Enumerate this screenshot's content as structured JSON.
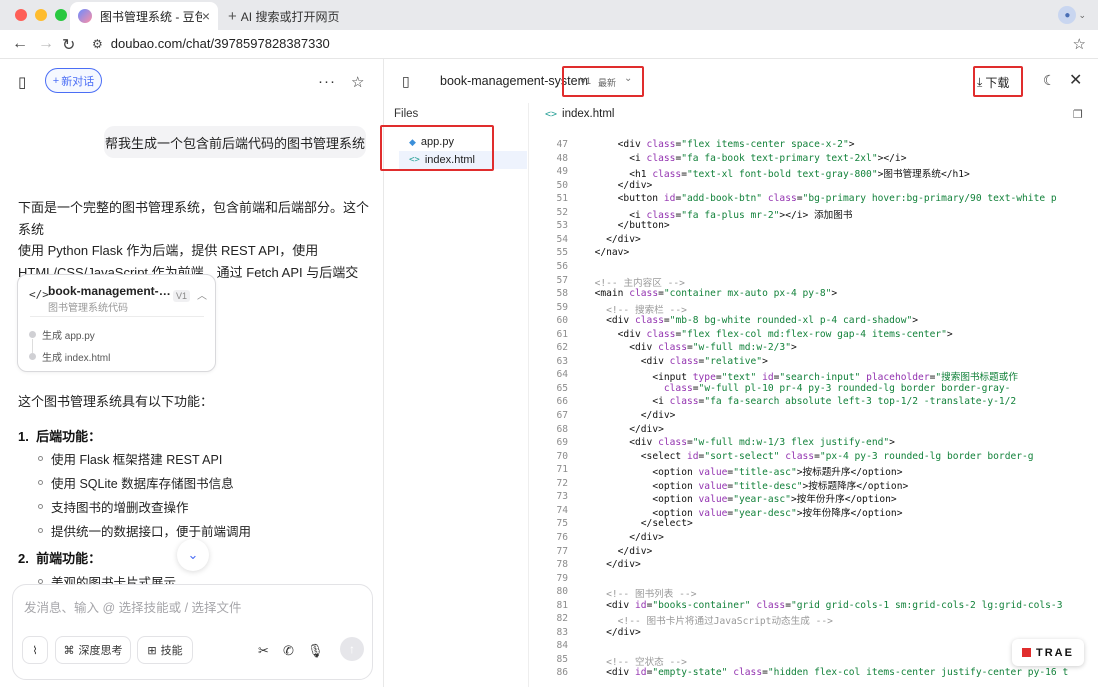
{
  "browser": {
    "tab_title": "图书管理系统 - 豆包",
    "new_tab_label": "AI 搜索或打开网页",
    "url": "doubao.com/chat/3978597828387330"
  },
  "chat": {
    "new_chat_label": "新对话",
    "user_message": "帮我生成一个包含前后端代码的图书管理系统",
    "intro_lines": [
      "下面是一个完整的图书管理系统，包含前端和后端部分。这个系统",
      "使用 Python Flask 作为后端，提供 REST API，使用",
      "HTML/CSS/JavaScript 作为前端，通过 Fetch API 与后端交互。"
    ],
    "card": {
      "name": "book-management-s...",
      "subtitle": "图书管理系统代码",
      "version": "V1",
      "steps": [
        "生成 app.py",
        "生成 index.html"
      ]
    },
    "features_title": "这个图书管理系统具有以下功能：",
    "backend": {
      "title": "后端功能：",
      "items": [
        "使用 Flask 框架搭建 REST API",
        "使用 SQLite 数据库存储图书信息",
        "支持图书的增删改查操作",
        "提供统一的数据接口，便于前端调用"
      ]
    },
    "frontend": {
      "title": "前端功能：",
      "items": [
        "美观的图书卡片式展示"
      ]
    },
    "input_placeholder": "发消息、输入 @ 选择技能或 / 选择文件",
    "deep_think_label": "深度思考",
    "skills_label": "技能"
  },
  "panel": {
    "project_name": "book-management-system",
    "version": "V1",
    "latest_label": "最新",
    "download_label": "下载",
    "files_header": "Files",
    "files": [
      "app.py",
      "index.html"
    ],
    "active_file": "index.html",
    "badge": "TRAE"
  },
  "code_lines": [
    {
      "n": "47",
      "i": 6,
      "p": [
        [
          "tg",
          "<div "
        ],
        [
          "at",
          "class"
        ],
        [
          "tg",
          "="
        ],
        [
          "sv",
          "\"flex items-center space-x-2\""
        ],
        [
          "tg",
          ">"
        ]
      ]
    },
    {
      "n": "48",
      "i": 8,
      "p": [
        [
          "tg",
          "<i "
        ],
        [
          "at",
          "class"
        ],
        [
          "tg",
          "="
        ],
        [
          "sv",
          "\"fa fa-book text-primary text-2xl\""
        ],
        [
          "tg",
          "></i>"
        ]
      ]
    },
    {
      "n": "49",
      "i": 8,
      "p": [
        [
          "tg",
          "<h1 "
        ],
        [
          "at",
          "class"
        ],
        [
          "tg",
          "="
        ],
        [
          "sv",
          "\"text-xl font-bold text-gray-800\""
        ],
        [
          "tg",
          ">图书管理系统</h1>"
        ]
      ]
    },
    {
      "n": "50",
      "i": 6,
      "p": [
        [
          "tg",
          "</div>"
        ]
      ]
    },
    {
      "n": "51",
      "i": 6,
      "p": [
        [
          "tg",
          "<button "
        ],
        [
          "at",
          "id"
        ],
        [
          "tg",
          "="
        ],
        [
          "sv",
          "\"add-book-btn\""
        ],
        [
          "tg",
          " "
        ],
        [
          "at",
          "class"
        ],
        [
          "tg",
          "="
        ],
        [
          "sv",
          "\"bg-primary hover:bg-primary/90 text-white p"
        ]
      ]
    },
    {
      "n": "52",
      "i": 8,
      "p": [
        [
          "tg",
          "<i "
        ],
        [
          "at",
          "class"
        ],
        [
          "tg",
          "="
        ],
        [
          "sv",
          "\"fa fa-plus mr-2\""
        ],
        [
          "tg",
          "></i> 添加图书"
        ]
      ]
    },
    {
      "n": "53",
      "i": 6,
      "p": [
        [
          "tg",
          "</button>"
        ]
      ]
    },
    {
      "n": "54",
      "i": 4,
      "p": [
        [
          "tg",
          "</div>"
        ]
      ]
    },
    {
      "n": "55",
      "i": 2,
      "p": [
        [
          "tg",
          "</nav>"
        ]
      ]
    },
    {
      "n": "56",
      "i": 0,
      "p": []
    },
    {
      "n": "57",
      "i": 2,
      "p": [
        [
          "cm",
          "<!-- 主内容区 -->"
        ]
      ]
    },
    {
      "n": "58",
      "i": 2,
      "p": [
        [
          "tg",
          "<main "
        ],
        [
          "at",
          "class"
        ],
        [
          "tg",
          "="
        ],
        [
          "sv",
          "\"container mx-auto px-4 py-8\""
        ],
        [
          "tg",
          ">"
        ]
      ]
    },
    {
      "n": "59",
      "i": 4,
      "p": [
        [
          "cm",
          "<!-- 搜索栏 -->"
        ]
      ]
    },
    {
      "n": "60",
      "i": 4,
      "p": [
        [
          "tg",
          "<div "
        ],
        [
          "at",
          "class"
        ],
        [
          "tg",
          "="
        ],
        [
          "sv",
          "\"mb-8 bg-white rounded-xl p-4 card-shadow\""
        ],
        [
          "tg",
          ">"
        ]
      ]
    },
    {
      "n": "61",
      "i": 6,
      "p": [
        [
          "tg",
          "<div "
        ],
        [
          "at",
          "class"
        ],
        [
          "tg",
          "="
        ],
        [
          "sv",
          "\"flex flex-col md:flex-row gap-4 items-center\""
        ],
        [
          "tg",
          ">"
        ]
      ]
    },
    {
      "n": "62",
      "i": 8,
      "p": [
        [
          "tg",
          "<div "
        ],
        [
          "at",
          "class"
        ],
        [
          "tg",
          "="
        ],
        [
          "sv",
          "\"w-full md:w-2/3\""
        ],
        [
          "tg",
          ">"
        ]
      ]
    },
    {
      "n": "63",
      "i": 10,
      "p": [
        [
          "tg",
          "<div "
        ],
        [
          "at",
          "class"
        ],
        [
          "tg",
          "="
        ],
        [
          "sv",
          "\"relative\""
        ],
        [
          "tg",
          ">"
        ]
      ]
    },
    {
      "n": "64",
      "i": 12,
      "p": [
        [
          "tg",
          "<input "
        ],
        [
          "at",
          "type"
        ],
        [
          "tg",
          "="
        ],
        [
          "sv",
          "\"text\""
        ],
        [
          "tg",
          " "
        ],
        [
          "at",
          "id"
        ],
        [
          "tg",
          "="
        ],
        [
          "sv",
          "\"search-input\""
        ],
        [
          "tg",
          " "
        ],
        [
          "at",
          "placeholder"
        ],
        [
          "tg",
          "="
        ],
        [
          "sv",
          "\"搜索图书标题或作"
        ]
      ]
    },
    {
      "n": "65",
      "i": 14,
      "p": [
        [
          "at",
          "class"
        ],
        [
          "tg",
          "="
        ],
        [
          "sv",
          "\"w-full pl-10 pr-4 py-3 rounded-lg border border-gray-"
        ]
      ]
    },
    {
      "n": "66",
      "i": 12,
      "p": [
        [
          "tg",
          "<i "
        ],
        [
          "at",
          "class"
        ],
        [
          "tg",
          "="
        ],
        [
          "sv",
          "\"fa fa-search absolute left-3 top-1/2 -translate-y-1/2"
        ]
      ]
    },
    {
      "n": "67",
      "i": 10,
      "p": [
        [
          "tg",
          "</div>"
        ]
      ]
    },
    {
      "n": "68",
      "i": 8,
      "p": [
        [
          "tg",
          "</div>"
        ]
      ]
    },
    {
      "n": "69",
      "i": 8,
      "p": [
        [
          "tg",
          "<div "
        ],
        [
          "at",
          "class"
        ],
        [
          "tg",
          "="
        ],
        [
          "sv",
          "\"w-full md:w-1/3 flex justify-end\""
        ],
        [
          "tg",
          ">"
        ]
      ]
    },
    {
      "n": "70",
      "i": 10,
      "p": [
        [
          "tg",
          "<select "
        ],
        [
          "at",
          "id"
        ],
        [
          "tg",
          "="
        ],
        [
          "sv",
          "\"sort-select\""
        ],
        [
          "tg",
          " "
        ],
        [
          "at",
          "class"
        ],
        [
          "tg",
          "="
        ],
        [
          "sv",
          "\"px-4 py-3 rounded-lg border border-g"
        ]
      ]
    },
    {
      "n": "71",
      "i": 12,
      "p": [
        [
          "tg",
          "<option "
        ],
        [
          "at",
          "value"
        ],
        [
          "tg",
          "="
        ],
        [
          "sv",
          "\"title-asc\""
        ],
        [
          "tg",
          ">按标题升序</option>"
        ]
      ]
    },
    {
      "n": "72",
      "i": 12,
      "p": [
        [
          "tg",
          "<option "
        ],
        [
          "at",
          "value"
        ],
        [
          "tg",
          "="
        ],
        [
          "sv",
          "\"title-desc\""
        ],
        [
          "tg",
          ">按标题降序</option>"
        ]
      ]
    },
    {
      "n": "73",
      "i": 12,
      "p": [
        [
          "tg",
          "<option "
        ],
        [
          "at",
          "value"
        ],
        [
          "tg",
          "="
        ],
        [
          "sv",
          "\"year-asc\""
        ],
        [
          "tg",
          ">按年份升序</option>"
        ]
      ]
    },
    {
      "n": "74",
      "i": 12,
      "p": [
        [
          "tg",
          "<option "
        ],
        [
          "at",
          "value"
        ],
        [
          "tg",
          "="
        ],
        [
          "sv",
          "\"year-desc\""
        ],
        [
          "tg",
          ">按年份降序</option>"
        ]
      ]
    },
    {
      "n": "75",
      "i": 10,
      "p": [
        [
          "tg",
          "</select>"
        ]
      ]
    },
    {
      "n": "76",
      "i": 8,
      "p": [
        [
          "tg",
          "</div>"
        ]
      ]
    },
    {
      "n": "77",
      "i": 6,
      "p": [
        [
          "tg",
          "</div>"
        ]
      ]
    },
    {
      "n": "78",
      "i": 4,
      "p": [
        [
          "tg",
          "</div>"
        ]
      ]
    },
    {
      "n": "79",
      "i": 0,
      "p": []
    },
    {
      "n": "80",
      "i": 4,
      "p": [
        [
          "cm",
          "<!-- 图书列表 -->"
        ]
      ]
    },
    {
      "n": "81",
      "i": 4,
      "p": [
        [
          "tg",
          "<div "
        ],
        [
          "at",
          "id"
        ],
        [
          "tg",
          "="
        ],
        [
          "sv",
          "\"books-container\""
        ],
        [
          "tg",
          " "
        ],
        [
          "at",
          "class"
        ],
        [
          "tg",
          "="
        ],
        [
          "sv",
          "\"grid grid-cols-1 sm:grid-cols-2 lg:grid-cols-3"
        ]
      ]
    },
    {
      "n": "82",
      "i": 6,
      "p": [
        [
          "cm",
          "<!-- 图书卡片将通过JavaScript动态生成 -->"
        ]
      ]
    },
    {
      "n": "83",
      "i": 4,
      "p": [
        [
          "tg",
          "</div>"
        ]
      ]
    },
    {
      "n": "84",
      "i": 0,
      "p": []
    },
    {
      "n": "85",
      "i": 4,
      "p": [
        [
          "cm",
          "<!-- 空状态 -->"
        ]
      ]
    },
    {
      "n": "86",
      "i": 4,
      "p": [
        [
          "tg",
          "<div "
        ],
        [
          "at",
          "id"
        ],
        [
          "tg",
          "="
        ],
        [
          "sv",
          "\"empty-state\""
        ],
        [
          "tg",
          " "
        ],
        [
          "at",
          "class"
        ],
        [
          "tg",
          "="
        ],
        [
          "sv",
          "\"hidden flex-col items-center justify-center py-16 t"
        ]
      ]
    }
  ]
}
